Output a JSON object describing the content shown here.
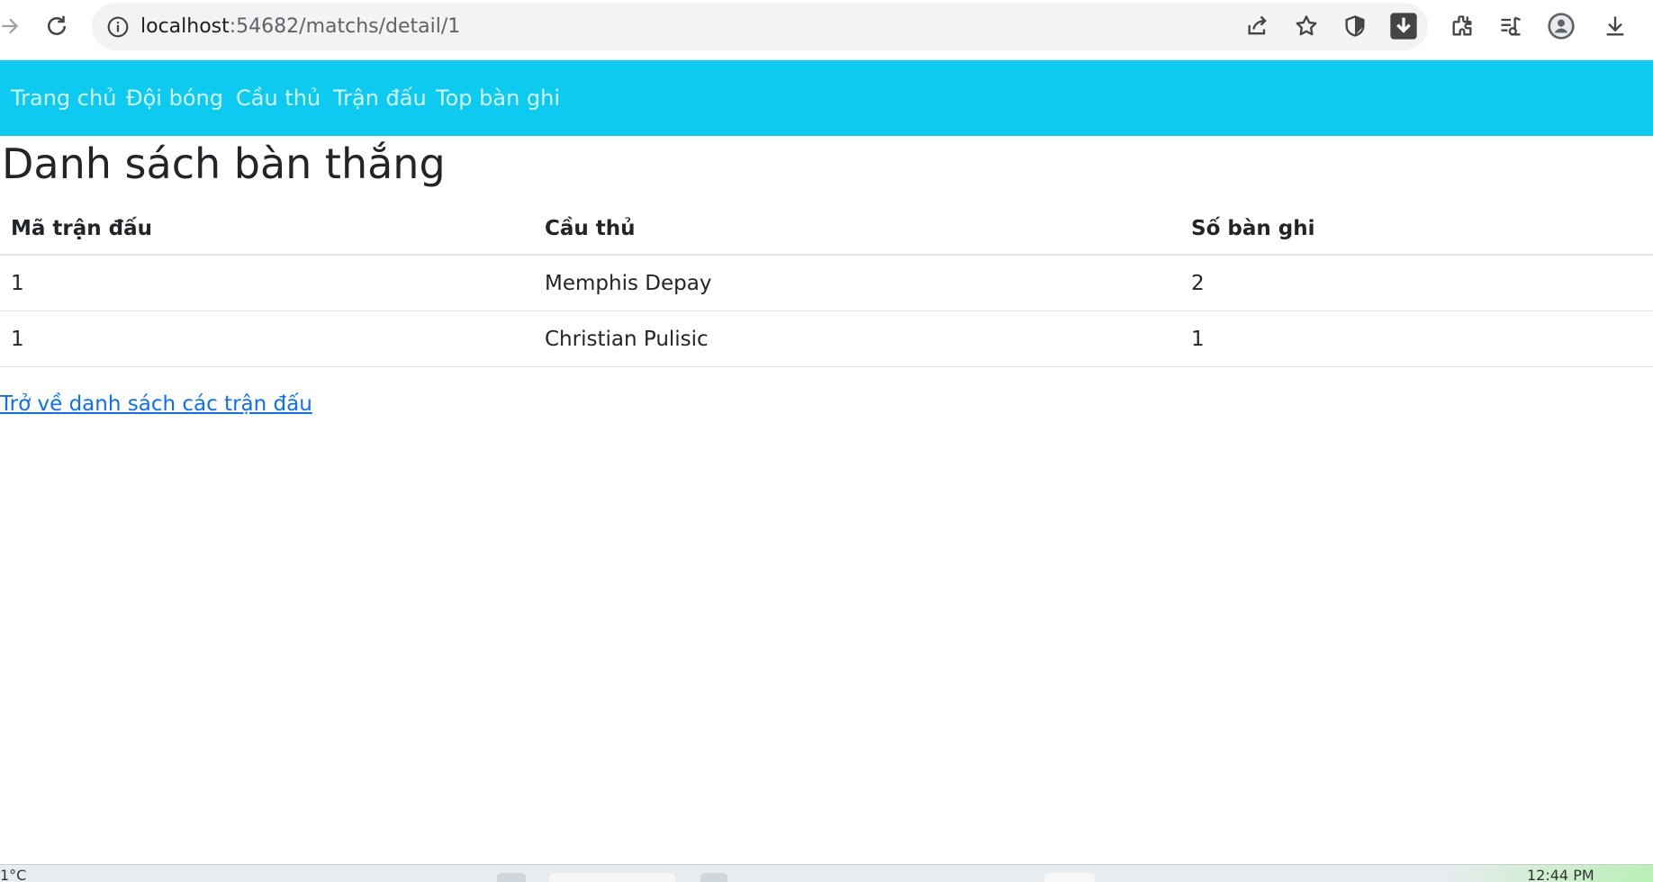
{
  "browser": {
    "url_host": "localhost",
    "url_path": ":54682/matchs/detail/1",
    "icons": [
      "forward-icon",
      "reload-icon",
      "site-info-icon",
      "share-icon",
      "bookmark-star-icon",
      "shield-icon",
      "download-badge-icon",
      "extensions-icon",
      "reading-list-icon",
      "profile-icon",
      "downloads-icon"
    ]
  },
  "navbar": {
    "items": [
      {
        "label": "Trang chủ"
      },
      {
        "label": "Đội bóng"
      },
      {
        "label": "Cầu thủ"
      },
      {
        "label": "Trận đấu"
      },
      {
        "label": "Top bàn ghi"
      }
    ],
    "bg_color": "#0dcaf0"
  },
  "main": {
    "title": "Danh sách bàn thắng",
    "table": {
      "headers": [
        "Mã trận đấu",
        "Cầu thủ",
        "Số bàn ghi"
      ],
      "rows": [
        [
          "1",
          "Memphis Depay",
          "2"
        ],
        [
          "1",
          "Christian Pulisic",
          "1"
        ]
      ]
    },
    "back_link": "Trở về danh sách các trận đấu",
    "link_color": "#0d6efd"
  },
  "taskbar": {
    "weather": "1°C",
    "clock": "12:44 PM"
  }
}
